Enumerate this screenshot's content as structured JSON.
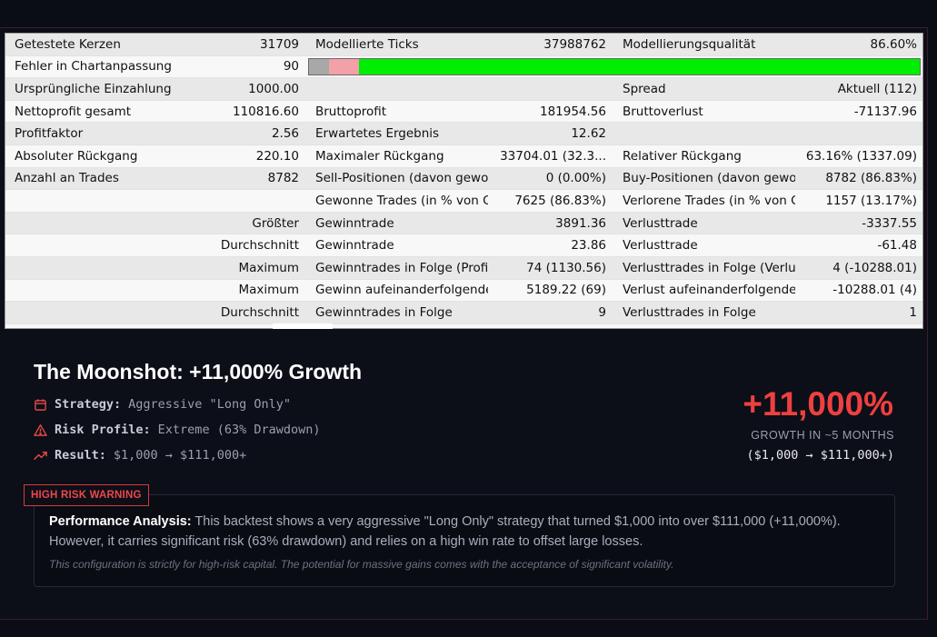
{
  "report": {
    "rows": [
      [
        "Getestete Kerzen",
        "31709",
        "Modellierte Ticks",
        "37988762",
        "Modellierungsqualität",
        "86.60%"
      ],
      [
        "Fehler in Chartanpassung",
        "90"
      ],
      [
        "Ursprüngliche Einzahlung",
        "1000.00",
        "",
        "",
        "Spread",
        "Aktuell (112)"
      ],
      [
        "Nettoprofit gesamt",
        "110816.60",
        "Bruttoprofit",
        "181954.56",
        "Bruttoverlust",
        "-71137.96"
      ],
      [
        "Profitfaktor",
        "2.56",
        "Erwartetes Ergebnis",
        "12.62",
        "",
        ""
      ],
      [
        "Absoluter Rückgang",
        "220.10",
        "Maximaler Rückgang",
        "33704.01 (32.3...",
        "Relativer Rückgang",
        "63.16% (1337.09)"
      ],
      [
        "Anzahl an Trades",
        "8782",
        "Sell-Positionen (davon gewo...",
        "0 (0.00%)",
        "Buy-Positionen (davon gewo...",
        "8782 (86.83%)"
      ],
      [
        "",
        "",
        "Gewonne Trades (in % von G...",
        "7625 (86.83%)",
        "Verlorene Trades (in % von G...",
        "1157 (13.17%)"
      ],
      [
        "",
        "Größter",
        "Gewinntrade",
        "3891.36",
        "Verlusttrade",
        "-3337.55"
      ],
      [
        "",
        "Durchschnitt",
        "Gewinntrade",
        "23.86",
        "Verlusttrade",
        "-61.48"
      ],
      [
        "",
        "Maximum",
        "Gewinntrades in Folge (Profit...",
        "74 (1130.56)",
        "Verlusttrades in Folge (Verlus...",
        "4 (-10288.01)"
      ],
      [
        "",
        "Maximum",
        "Gewinn aufeinanderfolgende...",
        "5189.22 (69)",
        "Verlust aufeinanderfolgende...",
        "-10288.01 (4)"
      ],
      [
        "",
        "Durchschnitt",
        "Gewinntrades in Folge",
        "9",
        "Verlusttrades in Folge",
        "1"
      ],
      [
        "",
        "",
        "",
        "",
        "",
        ""
      ]
    ],
    "quality_bar": {
      "gray_fraction": 0.032,
      "pink_fraction": 0.05,
      "colors": {
        "gray": "#a8a8a8",
        "pink": "#f4a0a8",
        "green": "#00ee00"
      }
    }
  },
  "headline": {
    "title": "The Moonshot: +11,000% Growth",
    "strategy_label": "Strategy:",
    "strategy_value": "Aggressive \"Long Only\"",
    "risk_label": "Risk Profile:",
    "risk_value": "Extreme (63% Drawdown)",
    "result_label": "Result:",
    "result_value": "$1,000 → $111,000+",
    "icons": [
      "calendar-icon",
      "warning-triangle-icon",
      "trend-up-icon"
    ]
  },
  "stat": {
    "big": "+11,000%",
    "caption": "GROWTH IN ~5 MONTHS",
    "range": "($1,000 → $111,000+)",
    "accent": "#ee4040"
  },
  "analysis": {
    "badge": "HIGH RISK WARNING",
    "lead": "Performance Analysis:",
    "text": " This backtest shows a very aggressive \"Long Only\" strategy that turned $1,000 into over $111,000 (+11,000%). However, it carries significant risk (63% drawdown) and relies on a high win rate to offset large losses.",
    "note": "This configuration is strictly for high-risk capital. The potential for massive gains comes with the acceptance of significant volatility."
  }
}
